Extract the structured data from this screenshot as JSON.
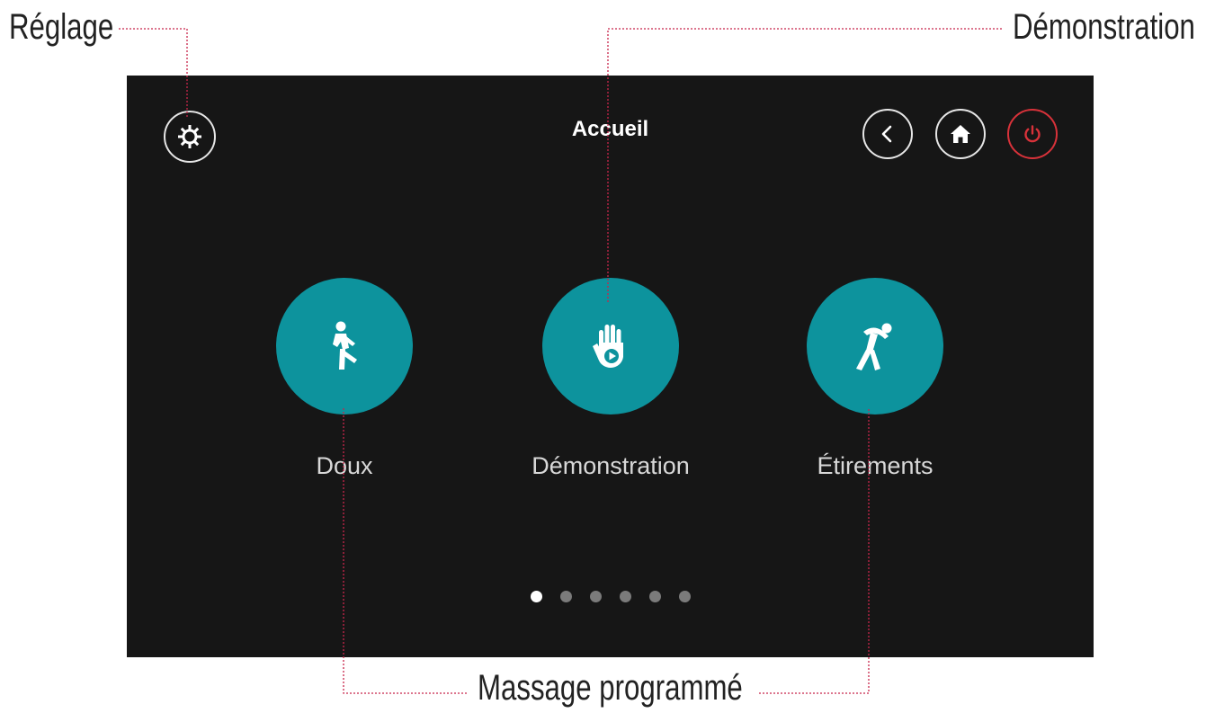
{
  "callouts": {
    "settings": "Réglage",
    "demo": "Démonstration",
    "programs": "Massage programmé"
  },
  "screen": {
    "title": "Accueil",
    "top_buttons": {
      "settings_icon": "gear-icon",
      "back_icon": "chevron-left-icon",
      "home_icon": "home-icon",
      "power_icon": "power-icon"
    },
    "tiles": [
      {
        "label": "Doux",
        "icon": "walking-person-icon"
      },
      {
        "label": "Démonstration",
        "icon": "hand-play-icon"
      },
      {
        "label": "Étirements",
        "icon": "stretching-person-icon"
      }
    ],
    "pagination": {
      "pages": 6,
      "active": 1
    }
  },
  "colors": {
    "screen_bg": "#161616",
    "tile": "#0d939d",
    "power": "#d8323a",
    "guide": "#c8254a",
    "dot_active": "#ffffff",
    "dot_inactive": "#7b7b7b"
  }
}
